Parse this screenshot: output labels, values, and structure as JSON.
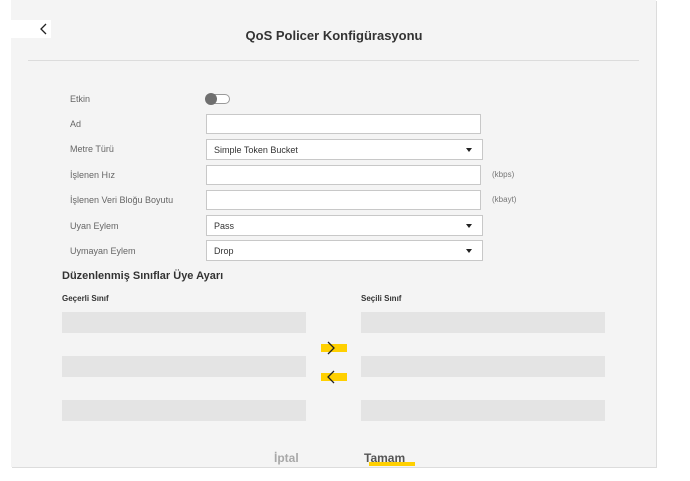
{
  "header": {
    "title": "QoS Policer Konfigürasyonu",
    "back_icon": "chevron-left-icon"
  },
  "form": {
    "enabled_label": "Etkin",
    "enabled_value": false,
    "name_label": "Ad",
    "name_value": "",
    "meter_type_label": "Metre Türü",
    "meter_type_value": "Simple Token Bucket",
    "committed_rate_label": "İşlenen Hız",
    "committed_rate_value": "",
    "committed_rate_unit": "(kbps)",
    "committed_burst_label": "İşlenen Veri Bloğu Boyutu",
    "committed_burst_value": "",
    "committed_burst_unit": "(kbayt)",
    "conform_action_label": "Uyan Eylem",
    "conform_action_value": "Pass",
    "nonconform_action_label": "Uymayan Eylem",
    "nonconform_action_value": "Drop"
  },
  "class_member": {
    "section_title": "Düzenlenmiş Sınıflar Üye Ayarı",
    "available_header": "Geçerli Sınıf",
    "selected_header": "Seçili Sınıf",
    "add_icon": "chevron-right-icon",
    "remove_icon": "chevron-left-icon"
  },
  "footer": {
    "cancel_label": "İptal",
    "ok_label": "Tamam"
  },
  "colors": {
    "accent": "#ffd000",
    "panel_bg": "#f4f4f4",
    "list_bg": "#e4e4e4"
  }
}
